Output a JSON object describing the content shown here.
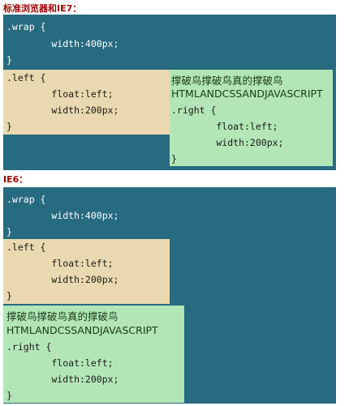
{
  "headings": {
    "standard": "标准浏览器和IE7：",
    "ie6": "IE6："
  },
  "wrap": {
    "selector": ".wrap {",
    "width": "        width:400px;",
    "close": "}"
  },
  "left": {
    "selector": ".left {",
    "float": "        float:left;",
    "width": "        width:200px;",
    "close": "}"
  },
  "right": {
    "text_cn": "撑破鸟撑破鸟真的撑破鸟",
    "text_en": "HTMLANDCSSANDJAVASCRIPT",
    "selector": ".right {",
    "float": "        float:left;",
    "width": "        width:200px;",
    "close": "}"
  },
  "colors": {
    "panel": "#276b80",
    "left_box": "#ead9b0",
    "right_box": "#b3e6b7",
    "heading": "#9e0000"
  }
}
